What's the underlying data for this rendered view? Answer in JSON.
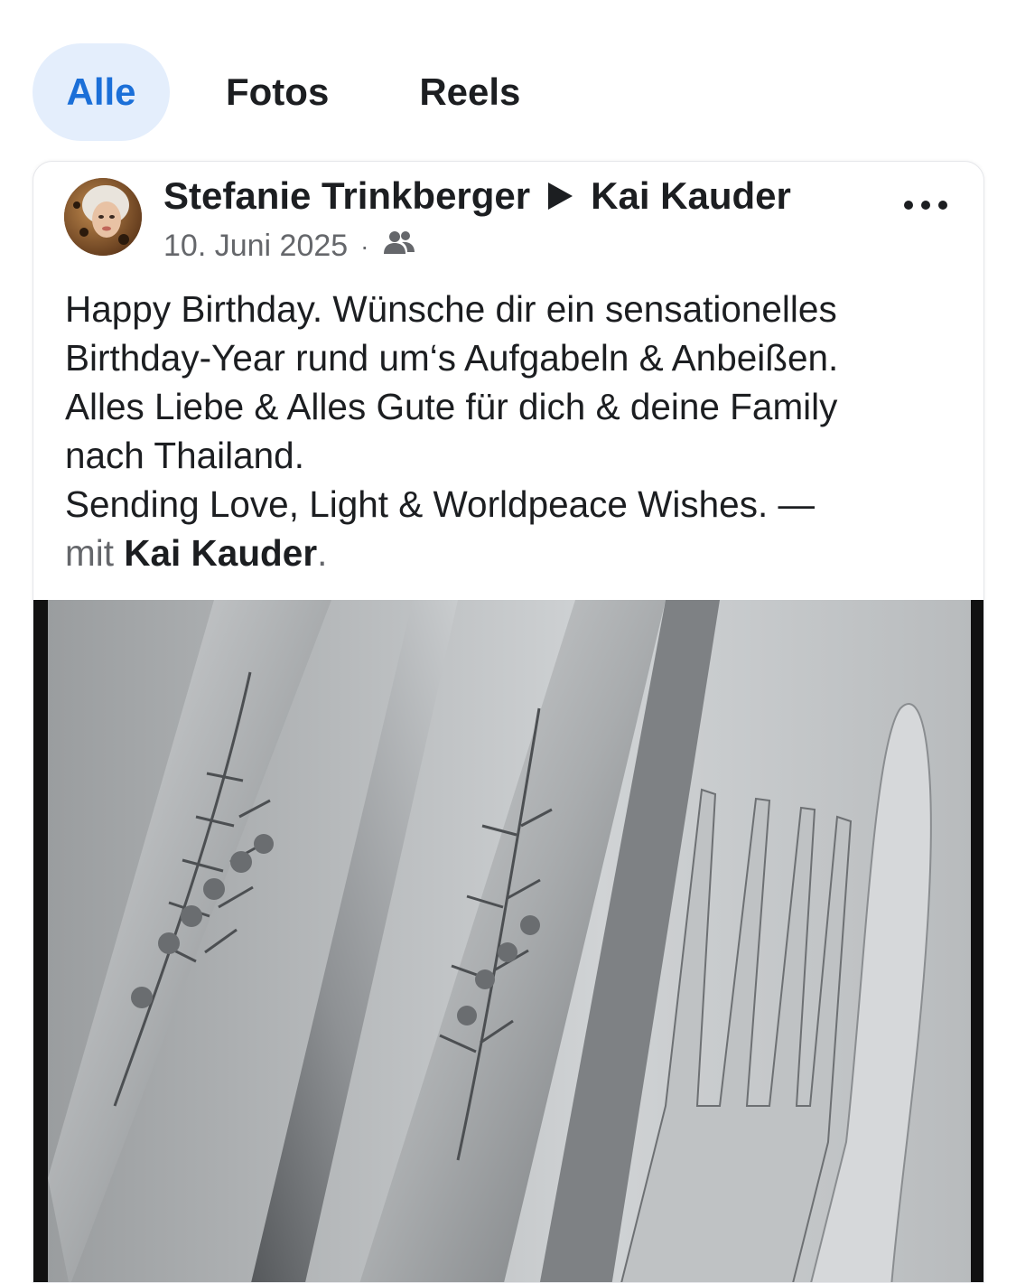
{
  "tabs": [
    {
      "label": "Alle",
      "active": true
    },
    {
      "label": "Fotos",
      "active": false
    },
    {
      "label": "Reels",
      "active": false
    }
  ],
  "post": {
    "author": "Stefanie Trinkberger",
    "recipient": "Kai Kauder",
    "date": "10. Juni 2025",
    "separator": "·",
    "audience_icon": "friends-icon",
    "text_lines": [
      "Happy Birthday. Wünsche dir ein sensationelles",
      "Birthday-Year rund um‘s Aufgabeln & Anbeißen.",
      "Alles Liebe & Alles Gute für dich & deine Family",
      "nach Thailand.",
      "Sending Love, Light & Worldpeace Wishes. —"
    ],
    "mit_label": "mit",
    "tagged": "Kai Kauder",
    "tag_end": ".",
    "image_icon": "engraved-silver-cutlery-photo"
  },
  "colors": {
    "active_tab_bg": "#e4eefc",
    "active_tab_text": "#1b6fd8",
    "secondary_text": "#65676b"
  }
}
